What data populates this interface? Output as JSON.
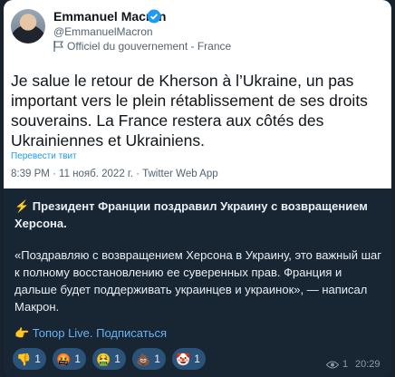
{
  "tweet": {
    "author_name": "Emmanuel Macron",
    "handle": "@EmmanuelMacron",
    "gov_label": "Officiel du gouvernement - France",
    "text": "Je salue le retour de Kherson à l’Ukraine, un pas important vers le plein rétablissement de ses droits souverains. La France restera aux côtés des Ukrainiennes et Ukrainiens.",
    "translate_link": "Перевести твит",
    "meta": "8:39 PM · 11 нояб. 2022 г. · Twitter Web App"
  },
  "post": {
    "headline": "⚡ Президент Франции поздравил Украину с возвращением Херсона.",
    "quote": "«Поздравляю с возвращением Херсона в Украину, это важный шаг к полному восстановлению ее суверенных прав. Франция и дальше будет поддерживать украинцев и украинок», — написал Макрон.",
    "subscribe_line": "👉 Топор Live. Подписаться"
  },
  "reactions": [
    {
      "emoji": "👎",
      "count": "1",
      "icon": "thumbs-down-icon"
    },
    {
      "emoji": "🤬",
      "count": "1",
      "icon": "angry-face-icon"
    },
    {
      "emoji": "🤮",
      "count": "1",
      "icon": "vomiting-face-icon"
    },
    {
      "emoji": "💩",
      "count": "1",
      "icon": "poop-icon"
    },
    {
      "emoji": "🤡",
      "count": "1",
      "icon": "clown-icon"
    }
  ],
  "footer": {
    "views": "1",
    "time": "20:29"
  },
  "colors": {
    "background": "#18222d",
    "bubble": "#182533",
    "link": "#6ab3f3",
    "reaction_bg": "#2b5278",
    "twitter_blue": "#1d9bf0"
  }
}
